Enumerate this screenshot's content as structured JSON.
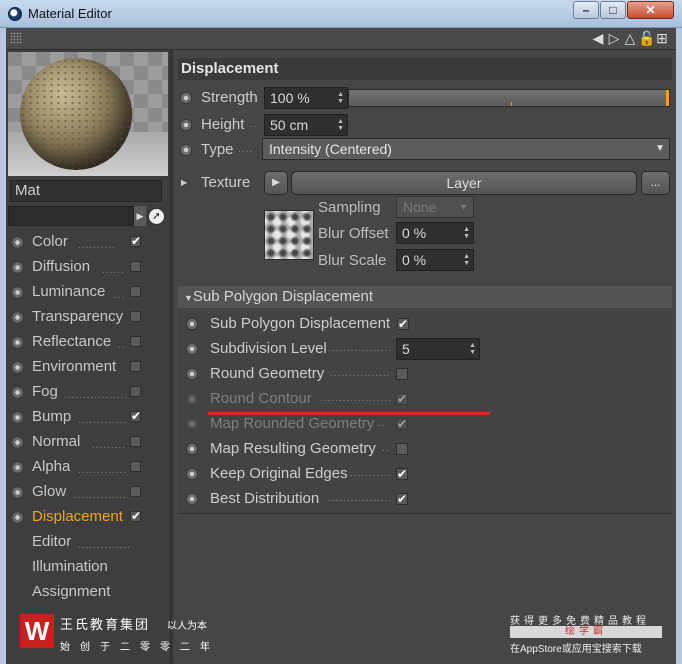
{
  "window": {
    "title": "Material Editor",
    "minimize": "–",
    "maximize": "□",
    "close": "✕"
  },
  "material": {
    "name": "Mat"
  },
  "channels": [
    {
      "label": "Color",
      "checked": true,
      "check": "✔"
    },
    {
      "label": "Diffusion",
      "checked": false,
      "check": ""
    },
    {
      "label": "Luminance",
      "checked": false,
      "check": ""
    },
    {
      "label": "Transparency",
      "checked": false,
      "check": ""
    },
    {
      "label": "Reflectance",
      "checked": false,
      "check": ""
    },
    {
      "label": "Environment",
      "checked": false,
      "check": ""
    },
    {
      "label": "Fog",
      "checked": false,
      "check": ""
    },
    {
      "label": "Bump",
      "checked": true,
      "check": "✔"
    },
    {
      "label": "Normal",
      "checked": false,
      "check": ""
    },
    {
      "label": "Alpha",
      "checked": false,
      "check": ""
    },
    {
      "label": "Glow",
      "checked": false,
      "check": ""
    },
    {
      "label": "Displacement",
      "checked": true,
      "check": "✔",
      "active": true
    },
    {
      "label": "Editor"
    },
    {
      "label": "Illumination"
    },
    {
      "label": "Assignment"
    }
  ],
  "displacement": {
    "section_title": "Displacement",
    "strength_label": "Strength",
    "strength_value": "100 %",
    "height_label": "Height",
    "height_value": "50 cm",
    "type_label": "Type",
    "type_dots": "....",
    "type_value": "Intensity (Centered)",
    "texture_label": "Texture",
    "texture_layer": "Layer",
    "texture_more": "...",
    "sampling_label": "Sampling",
    "sampling_value": "None",
    "blur_offset_label": "Blur Offset",
    "blur_offset_value": "0 %",
    "blur_scale_label": "Blur Scale",
    "blur_scale_value": "0 %"
  },
  "subpoly": {
    "header": "Sub Polygon Displacement",
    "rows": [
      {
        "label": "Sub Polygon Displacement",
        "checked": true,
        "check": "✔"
      },
      {
        "label": "Subdivision Level",
        "value": "5"
      },
      {
        "label": "Round Geometry",
        "checked": false,
        "check": ""
      },
      {
        "label": "Round Contour",
        "checked": true,
        "check": "✔",
        "disabled": true
      },
      {
        "label": "Map Rounded Geometry",
        "checked": true,
        "check": "✔",
        "disabled": true
      },
      {
        "label": "Map Resulting Geometry",
        "checked": false,
        "check": ""
      },
      {
        "label": "Keep Original Edges",
        "checked": true,
        "check": "✔"
      },
      {
        "label": "Best Distribution",
        "checked": true,
        "check": "✔"
      }
    ]
  },
  "watermark_left": {
    "logo": "W",
    "name": "王氏教育集团",
    "motto": "以人为本",
    "tagline": "始创于二零零二年"
  },
  "watermark_right": {
    "top": "获得更多免费精品教程",
    "brand": "绘学霸",
    "bottom": "在AppStore或应用宝搜索下载"
  },
  "colors": {
    "accent": "#f5a21a",
    "highlight_line": "#d42a1f"
  }
}
